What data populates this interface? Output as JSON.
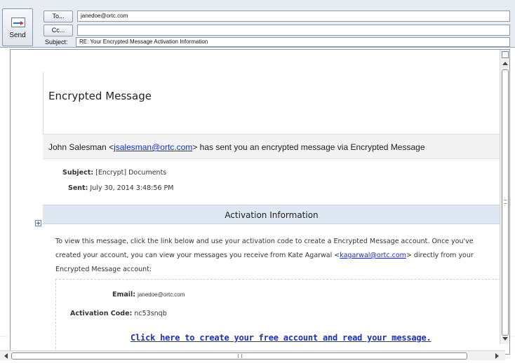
{
  "compose": {
    "send_label": "Send",
    "to_label": "To...",
    "cc_label": "Cc...",
    "to_value": "janedoe@ortc.com",
    "cc_value": "",
    "subject_label": "Subject:",
    "subject_value": "RE: Your Encrypted Message Activation Information"
  },
  "message": {
    "title": "Encrypted Message",
    "sender_name": "John Salesman",
    "sender_email": "jsalesman@ortc.com",
    "sender_suffix": "has sent you an encrypted message via Encrypted Message",
    "subject_label": "Subject:",
    "subject_value": "[Encrypt] Documents",
    "sent_label": "Sent:",
    "sent_value": "July 30, 2014 3:48:56 PM",
    "activation_title": "Activation Information",
    "paragraph_before": "To view this message, click the link below and use your activation code to create a Encrypted Message account. Once you've created your account, you can view your messages you receive from Kate Agarwal <",
    "paragraph_link": "kagarwal@ortc.com",
    "paragraph_after": "> directly from your Encrypted Message account:",
    "email_label": "Email:",
    "email_value": "janedoe@ortc.com",
    "code_label": "Activation Code:",
    "code_value": "nc53snqb",
    "cta_label": "Click here to create your free account and read your message."
  },
  "colors": {
    "link": "#1a2fbf",
    "activation_band": "#dde8f2",
    "header_bg": "#e7ebf2"
  }
}
